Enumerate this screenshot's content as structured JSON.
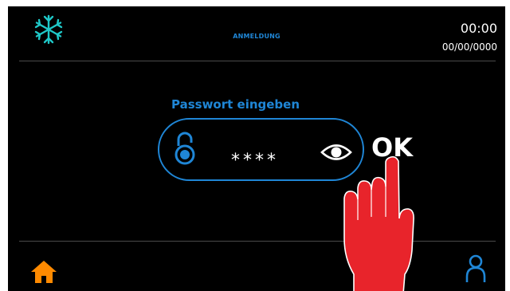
{
  "header": {
    "title": "ANMELDUNG",
    "time": "00:00",
    "date": "00/00/0000",
    "mode_icon": "snowflake-icon"
  },
  "login": {
    "prompt": "Passwort eingeben",
    "masked_password": "****",
    "lock_icon": "lock-icon",
    "reveal_icon": "eye-icon",
    "ok_label": "OK"
  },
  "footer": {
    "home_icon": "home-icon",
    "user_icon": "user-icon"
  },
  "overlay": {
    "pointer_icon": "hand-pointer-icon"
  },
  "colors": {
    "background": "#000000",
    "accent": "#1f86d6",
    "text": "#ffffff",
    "home": "#ff8a00",
    "pointer": "#e8242b"
  }
}
